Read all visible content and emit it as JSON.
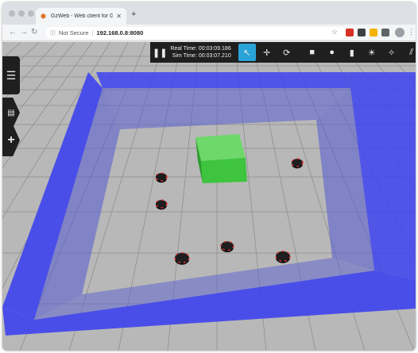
{
  "browser": {
    "tab": {
      "title": "GzWeb - Web client for Gazebo",
      "close_icon": "close-icon"
    },
    "new_tab_label": "+",
    "address": {
      "security_label": "Not Secure",
      "url": "192.168.0.8:8080"
    },
    "extensions": [
      {
        "name": "ext-red-icon",
        "color": "#d93025"
      },
      {
        "name": "ext-dark-icon",
        "color": "#3c4043"
      },
      {
        "name": "ext-multicolor-icon",
        "color": "#f4b400"
      },
      {
        "name": "ext-puzzle-icon",
        "color": "#5f6368"
      }
    ]
  },
  "toolbar": {
    "pause_icon": "pause-icon",
    "real_time_label": "Real Time: 00:03:09.186",
    "sim_time_label": "Sim Time: 00:03:07.210",
    "tools": [
      {
        "name": "select-mode-icon",
        "glyph": "↖",
        "active": true
      },
      {
        "name": "translate-mode-icon",
        "glyph": "✛",
        "active": false
      },
      {
        "name": "rotate-mode-icon",
        "glyph": "⟳",
        "active": false
      },
      {
        "name": "box-shape-icon",
        "glyph": "■",
        "active": false
      },
      {
        "name": "sphere-shape-icon",
        "glyph": "●",
        "active": false
      },
      {
        "name": "cylinder-shape-icon",
        "glyph": "▮",
        "active": false
      },
      {
        "name": "point-light-icon",
        "glyph": "☀",
        "active": false
      },
      {
        "name": "spot-light-icon",
        "glyph": "✧",
        "active": false
      },
      {
        "name": "directional-light-icon",
        "glyph": "⫽",
        "active": false
      }
    ]
  },
  "side_panel": {
    "menu_glyph": "☰",
    "insert_glyph": "+"
  },
  "scene": {
    "ground_color": "#b8b8b8",
    "grid_color": "#8f8f8f",
    "wall_color": "#3e43ee",
    "box_color": "#3ec43e",
    "robot_color": "#1e1e1e",
    "robot_marker_color": "#e23333"
  }
}
